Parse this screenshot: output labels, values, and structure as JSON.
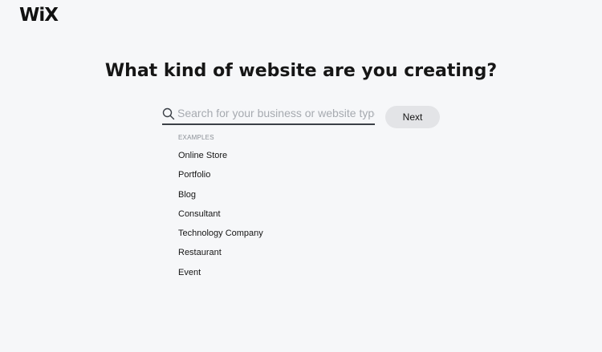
{
  "brand": {
    "logo_text": "WiX"
  },
  "main": {
    "heading": "What kind of website are you creating?",
    "search": {
      "placeholder": "Search for your business or website type",
      "value": ""
    },
    "next_label": "Next",
    "examples_label": "EXAMPLES",
    "examples": [
      "Online Store",
      "Portfolio",
      "Blog",
      "Consultant",
      "Technology Company",
      "Restaurant",
      "Event"
    ]
  },
  "colors": {
    "background": "#f6f7f9",
    "button_bg": "#e3e4e7",
    "underline": "#3b4047",
    "placeholder": "#a6aab0"
  },
  "icons": {
    "search": "search-icon"
  }
}
